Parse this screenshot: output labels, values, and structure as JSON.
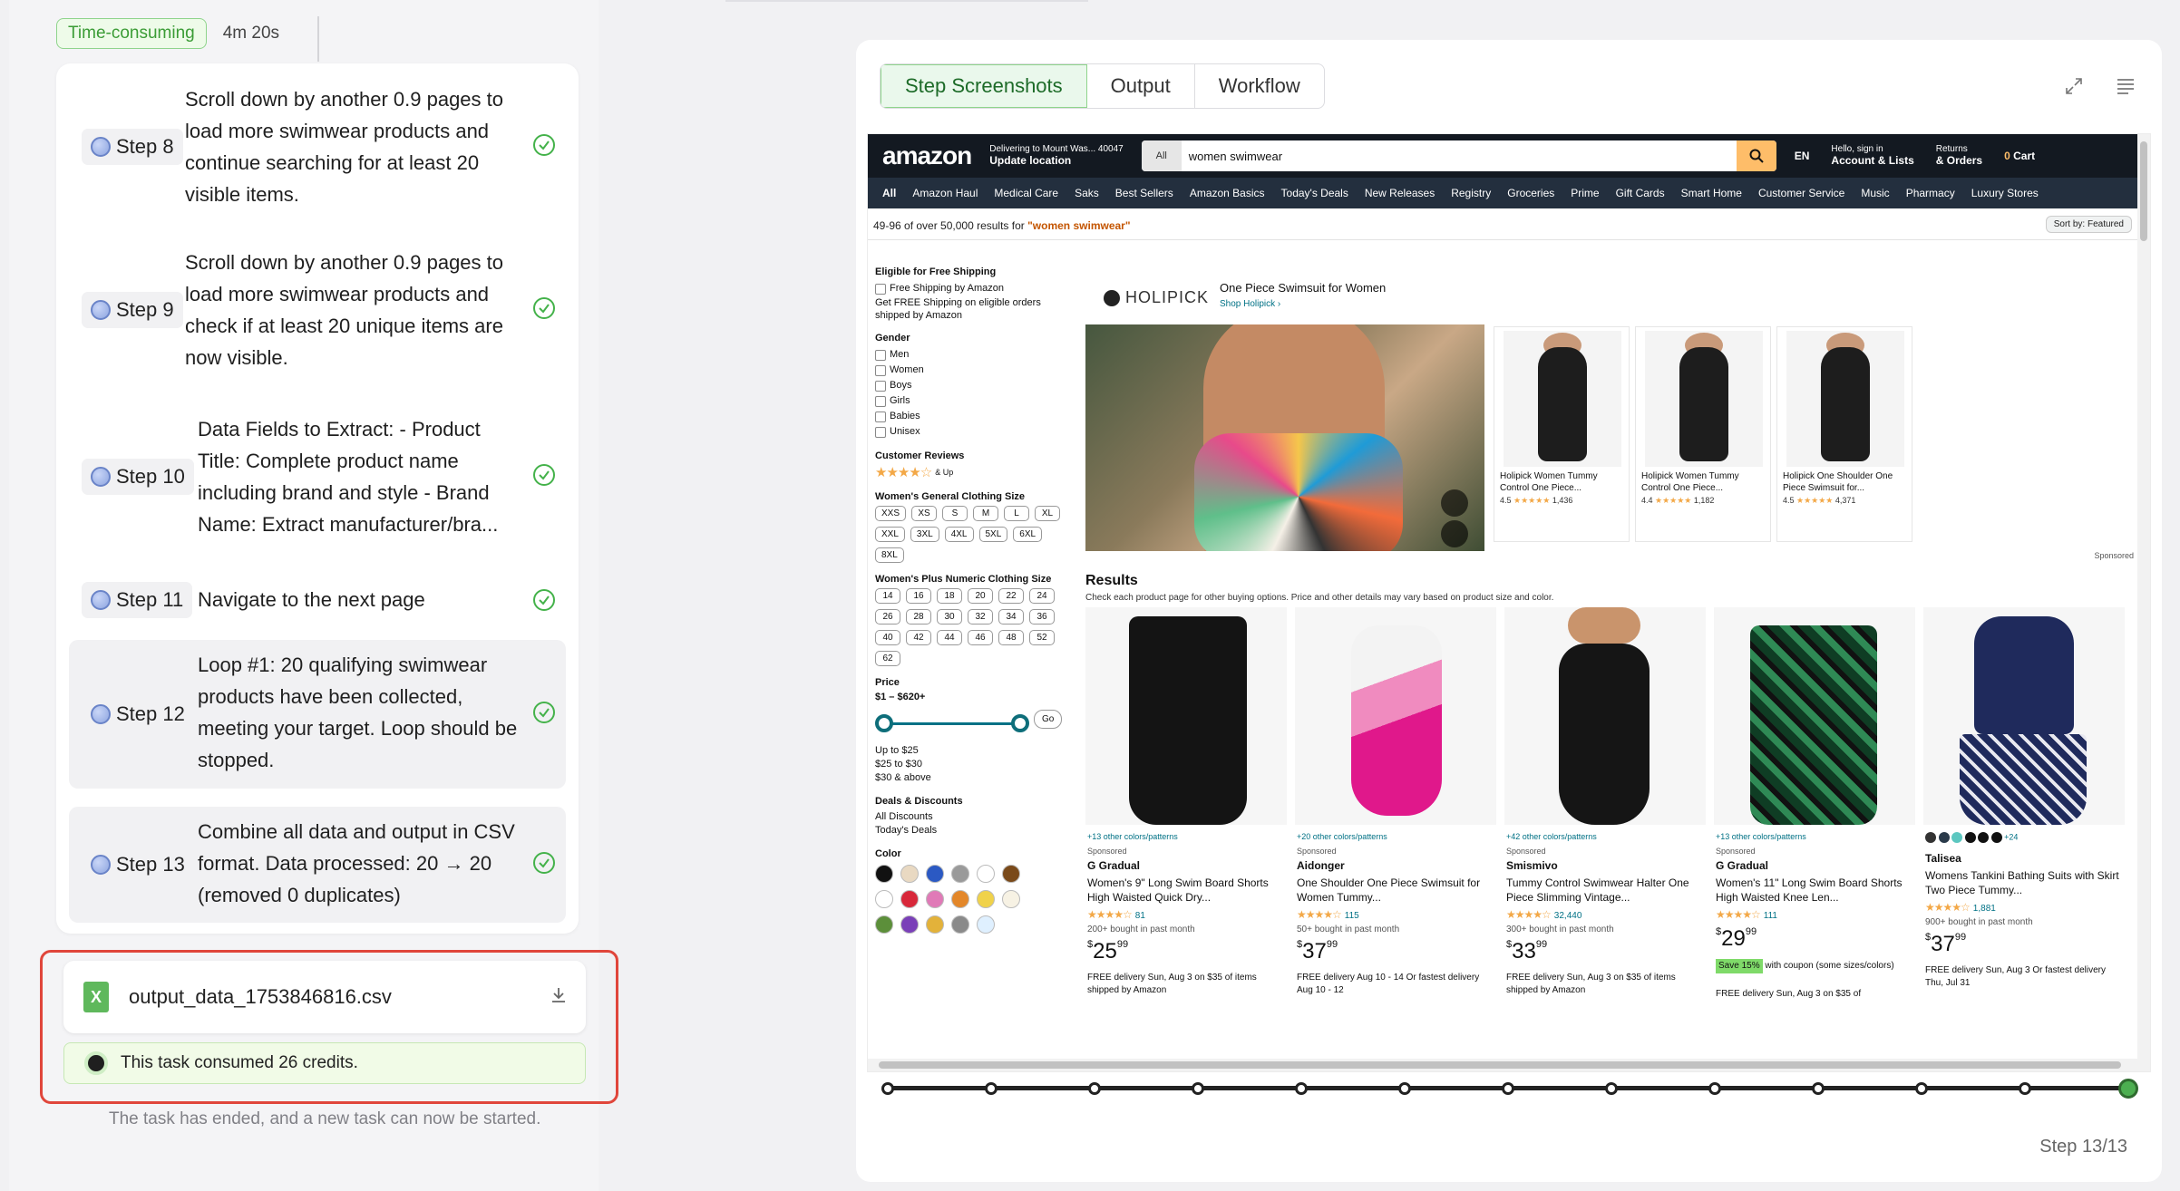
{
  "header": {
    "tag": "Time-consuming",
    "duration": "4m 20s"
  },
  "steps": [
    {
      "label": "Step 8",
      "text": "Scroll down by another 0.9 pages to load more swimwear products and continue searching for at least 20 visible items."
    },
    {
      "label": "Step 9",
      "text": "Scroll down by another 0.9 pages to load more swimwear products and check if at least 20 unique items are now visible."
    },
    {
      "label": "Step 10",
      "text": "Data Fields to Extract: - Product Title: Complete product name including brand and style - Brand Name: Extract manufacturer/bra..."
    },
    {
      "label": "Step 11",
      "text": "Navigate to the next page"
    },
    {
      "label": "Step 12",
      "text": "Loop #1: 20 qualifying swimwear products have been collected, meeting your target. Loop should be stopped."
    },
    {
      "label": "Step 13",
      "text": "Combine all data and output in CSV format. Data processed: 20 → 20 (removed 0 duplicates)"
    }
  ],
  "file": {
    "name": "output_data_1753846816.csv",
    "icon": "X"
  },
  "credits": "This task consumed 26 credits.",
  "ended": "The task has ended, and a new task can now be started.",
  "tabs": [
    "Step Screenshots",
    "Output",
    "Workflow"
  ],
  "step_counter": "Step 13/13",
  "amazon": {
    "logo": "amazon",
    "deliver_line1": "Delivering to Mount Was... 40047",
    "deliver_line2": "Update location",
    "search_cat": "All",
    "search_query": "women swimwear",
    "lang": "EN",
    "account_line1": "Hello, sign in",
    "account_line2": "Account & Lists",
    "returns_line1": "Returns",
    "returns_line2": "& Orders",
    "cart": "Cart",
    "cart_count": "0",
    "nav": [
      "All",
      "Amazon Haul",
      "Medical Care",
      "Saks",
      "Best Sellers",
      "Amazon Basics",
      "Today's Deals",
      "New Releases",
      "Registry",
      "Groceries",
      "Prime",
      "Gift Cards",
      "Smart Home",
      "Customer Service",
      "Music",
      "Pharmacy",
      "Luxury Stores"
    ],
    "results_prefix": "49-96 of over 50,000 results for ",
    "results_query": "\"women swimwear\"",
    "sort": "Sort by: Featured",
    "filters": {
      "shipping_h": "Eligible for Free Shipping",
      "shipping_opt": "Free Shipping by Amazon",
      "shipping_note": "Get FREE Shipping on eligible orders shipped by Amazon",
      "gender_h": "Gender",
      "genders": [
        "Men",
        "Women",
        "Boys",
        "Girls",
        "Babies",
        "Unisex"
      ],
      "reviews_h": "Customer Reviews",
      "reviews_up": "& Up",
      "size_h": "Women's General Clothing Size",
      "sizes": [
        "XXS",
        "XS",
        "S",
        "M",
        "L",
        "XL",
        "XXL",
        "3XL",
        "4XL",
        "5XL",
        "6XL",
        "8XL"
      ],
      "plus_h": "Women's Plus Numeric Clothing Size",
      "plus_sizes": [
        "14",
        "16",
        "18",
        "20",
        "22",
        "24",
        "26",
        "28",
        "30",
        "32",
        "34",
        "36",
        "40",
        "42",
        "44",
        "46",
        "48",
        "52",
        "62"
      ],
      "price_h": "Price",
      "price_range": "$1 – $620+",
      "go": "Go",
      "price_opts": [
        "Up to $25",
        "$25 to $30",
        "$30 & above"
      ],
      "deals_h": "Deals & Discounts",
      "deals": [
        "All Discounts",
        "Today's Deals"
      ],
      "color_h": "Color",
      "colors": [
        "#111111",
        "#e9d9c2",
        "#2b59c3",
        "#9a9a9a",
        "#ffffff",
        "#7a4a1a",
        "#ffffff",
        "#d8283a",
        "#e07ab7",
        "#e3872a",
        "#f0d24a",
        "#f7f2e4",
        "#5c8f3a",
        "#7a3fb8",
        "#e3b23a",
        "#8a8a8a",
        "#dff0ff"
      ]
    },
    "brand_banner": {
      "logo": "HOLIPICK",
      "title": "One Piece Swimsuit for Women",
      "sub": "Shop Holipick ›"
    },
    "minis": [
      {
        "title": "Holipick Women Tummy Control One Piece...",
        "rating": "4.5",
        "count": "1,436"
      },
      {
        "title": "Holipick Women Tummy Control One Piece...",
        "rating": "4.4",
        "count": "1,182"
      },
      {
        "title": "Holipick One Shoulder One Piece Swimsuit for...",
        "rating": "4.5",
        "count": "4,371"
      }
    ],
    "sponsored": "Sponsored",
    "results_h": "Results",
    "results_sub": "Check each product page for other buying options. Price and other details may vary based on product size and color.",
    "products": [
      {
        "more": "+13 other colors/patterns",
        "spon": "Sponsored",
        "brand": "G Gradual",
        "title": "Women's 9\" Long Swim Board Shorts High Waisted Quick Dry...",
        "count": "81",
        "bought": "200+ bought in past month",
        "price": "25",
        "cents": "99",
        "delivery": "FREE delivery Sun, Aug 3 on $35 of items shipped by Amazon"
      },
      {
        "more": "+20 other colors/patterns",
        "spon": "Sponsored",
        "brand": "Aidonger",
        "title": "One Shoulder One Piece Swimsuit for Women Tummy...",
        "count": "115",
        "bought": "50+ bought in past month",
        "price": "37",
        "cents": "99",
        "delivery": "FREE delivery Aug 10 - 14 Or fastest delivery Aug 10 - 12"
      },
      {
        "more": "+42 other colors/patterns",
        "spon": "Sponsored",
        "brand": "Smismivo",
        "title": "Tummy Control Swimwear Halter One Piece Slimming Vintage...",
        "count": "32,440",
        "bought": "300+ bought in past month",
        "price": "33",
        "cents": "99",
        "delivery": "FREE delivery Sun, Aug 3 on $35 of items shipped by Amazon"
      },
      {
        "more": "+13 other colors/patterns",
        "spon": "Sponsored",
        "brand": "G Gradual",
        "title": "Women's 11\" Long Swim Board Shorts High Waisted Knee Len...",
        "count": "111",
        "bought": "",
        "price": "29",
        "cents": "99",
        "save": "Save 15%",
        "save_note": "with coupon (some sizes/colors)",
        "delivery": "FREE delivery Sun, Aug 3 on $35 of"
      },
      {
        "more": "+24",
        "spon": "",
        "brand": "Talisea",
        "title": "Womens Tankini Bathing Suits with Skirt Two Piece Tummy...",
        "count": "1,881",
        "bought": "900+ bought in past month",
        "price": "37",
        "cents": "99",
        "delivery": "FREE delivery Sun, Aug 3 Or fastest delivery Thu, Jul 31"
      }
    ]
  }
}
